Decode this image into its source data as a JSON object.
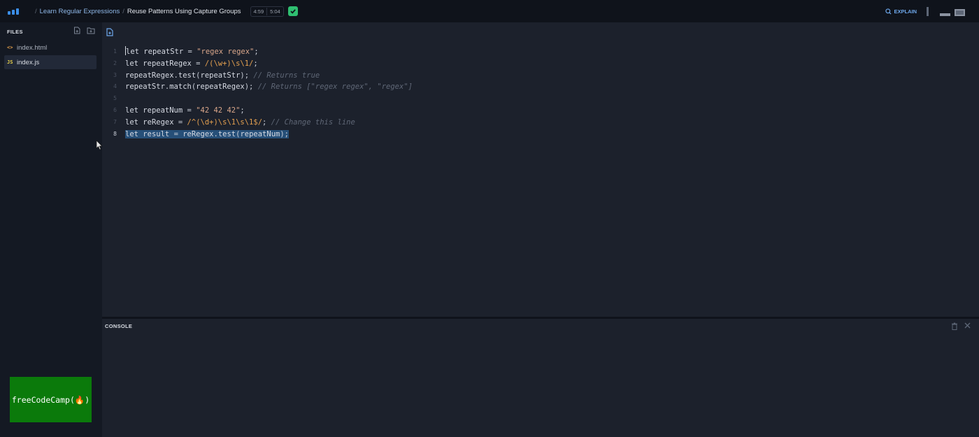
{
  "header": {
    "breadcrumb_separator": "/",
    "course": "Learn Regular Expressions",
    "lesson": "Reuse Patterns Using Capture Groups",
    "timer_current": "4:59",
    "timer_total": "5:04",
    "explain_label": "EXPLAIN"
  },
  "sidebar": {
    "title": "FILES",
    "files": [
      {
        "name": "index.html",
        "icon": "<>",
        "icon_color": "#e7a14a"
      },
      {
        "name": "index.js",
        "icon": "JS",
        "icon_color": "#e7d04a"
      }
    ],
    "badge": "freeCodeCamp(🔥)"
  },
  "editor": {
    "active_line": 8,
    "line_numbers": [
      "1",
      "2",
      "3",
      "4",
      "5",
      "6",
      "7",
      "8"
    ],
    "lines": [
      "let repeatStr = \"regex regex\";",
      "let repeatRegex = /(\\w+)\\s\\1/;",
      "repeatRegex.test(repeatStr); // Returns true",
      "repeatStr.match(repeatRegex); // Returns [\"regex regex\", \"regex\"]",
      "",
      "let repeatNum = \"42 42 42\";",
      "let reRegex = /^(\\d+)\\s\\1\\s\\1$/; // Change this line",
      "let result = reRegex.test(repeatNum);"
    ]
  },
  "console": {
    "title": "CONSOLE"
  },
  "colors": {
    "accent": "#3b8ee8",
    "success": "#2fbf71",
    "badge_bg": "#0b7a0b",
    "selection": "#264f78"
  }
}
